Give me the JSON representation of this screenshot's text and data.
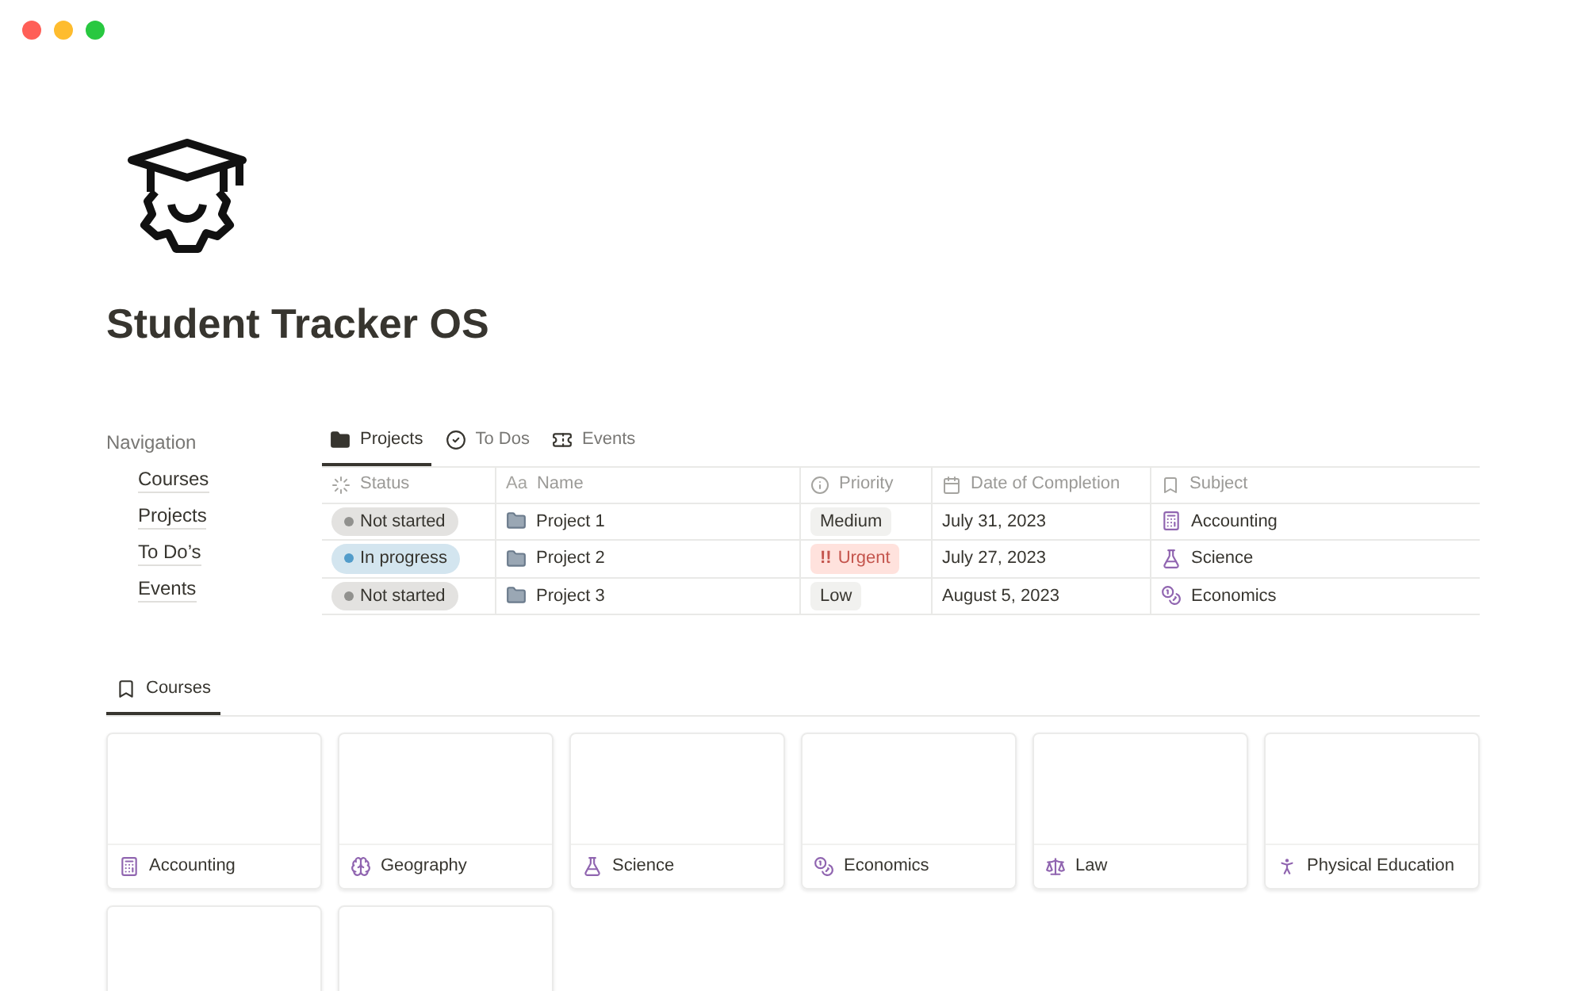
{
  "page": {
    "title": "Student Tracker OS"
  },
  "navigation": {
    "heading": "Navigation",
    "items": [
      {
        "label": "Courses"
      },
      {
        "label": "Projects"
      },
      {
        "label": "To Do’s"
      },
      {
        "label": "Events"
      }
    ]
  },
  "projects_view": {
    "tabs": [
      {
        "label": "Projects",
        "kind": "folder",
        "selected": true
      },
      {
        "label": "To Dos",
        "kind": "check",
        "selected": false
      },
      {
        "label": "Events",
        "kind": "ticket",
        "selected": false
      }
    ],
    "columns": [
      {
        "label": "Status",
        "kind": "status"
      },
      {
        "label": "Name",
        "kind": "name",
        "icon_text": "Aa"
      },
      {
        "label": "Priority",
        "kind": "priority"
      },
      {
        "label": "Date of Completion",
        "kind": "date"
      },
      {
        "label": "Subject",
        "kind": "subject"
      }
    ],
    "rows": [
      {
        "status": {
          "label": "Not started",
          "color": "#91918e"
        },
        "name": "Project 1",
        "priority": {
          "label": "Medium",
          "kind": "normal"
        },
        "date": "July 31, 2023",
        "subject": {
          "label": "Accounting",
          "kind": "accounting"
        }
      },
      {
        "status": {
          "label": "In progress",
          "color": "#529cca"
        },
        "name": "Project 2",
        "priority": {
          "label": "Urgent",
          "kind": "urgent",
          "marker": "!!"
        },
        "date": "July 27, 2023",
        "subject": {
          "label": "Science",
          "kind": "science"
        }
      },
      {
        "status": {
          "label": "Not started",
          "color": "#91918e"
        },
        "name": "Project 3",
        "priority": {
          "label": "Low",
          "kind": "normal"
        },
        "date": "August 5, 2023",
        "subject": {
          "label": "Economics",
          "kind": "economics"
        }
      }
    ]
  },
  "courses_view": {
    "tabs": [
      {
        "label": "Courses",
        "selected": true
      }
    ],
    "cards": [
      {
        "label": "Accounting",
        "kind": "accounting"
      },
      {
        "label": "Geography",
        "kind": "geography"
      },
      {
        "label": "Science",
        "kind": "science"
      },
      {
        "label": "Economics",
        "kind": "economics"
      },
      {
        "label": "Law",
        "kind": "law"
      },
      {
        "label": "Physical Education",
        "kind": "pe"
      },
      {
        "kind": "blank"
      },
      {
        "kind": "blank"
      }
    ]
  }
}
